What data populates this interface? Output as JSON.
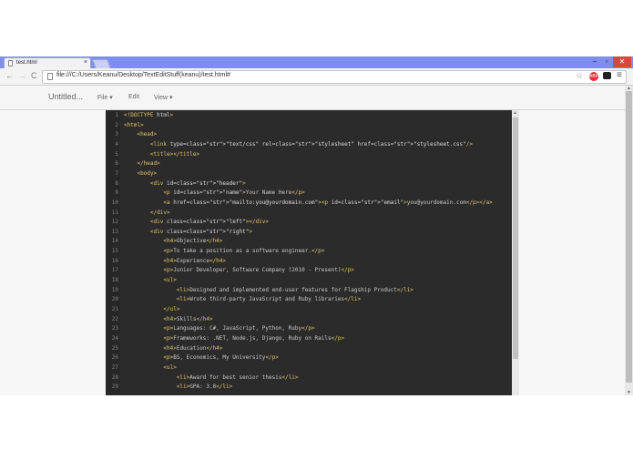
{
  "browser": {
    "tab_title": "test.html",
    "tab_close": "×",
    "url": "file:///C:/Users/Keanu/Desktop/TextEditStuff(keanu)/test.html#",
    "window_controls": {
      "minimize": "–",
      "maximize": "▫",
      "close": "✕"
    },
    "nav": {
      "back": "←",
      "forward": "→",
      "reload": "C"
    },
    "star_icon": "☆",
    "extension_badge": "ABP",
    "menu_icon": "≡"
  },
  "app": {
    "doc_title": "Untitled...",
    "menus": [
      {
        "label": "File ▾"
      },
      {
        "label": "Edit"
      },
      {
        "label": "View ▾"
      }
    ]
  },
  "editor": {
    "lines": [
      {
        "n": "1",
        "code": "<!DOCTYPE html>"
      },
      {
        "n": "2",
        "code": "<html>"
      },
      {
        "n": "3",
        "code": "    <head>"
      },
      {
        "n": "4",
        "code": "        <link type=\"text/css\" rel=\"stylesheet\" href=\"stylesheet.css\"/>"
      },
      {
        "n": "5",
        "code": "        <title></title>"
      },
      {
        "n": "6",
        "code": "    </head>"
      },
      {
        "n": "7",
        "code": "    <body>"
      },
      {
        "n": "8",
        "code": "        <div id=\"header\">"
      },
      {
        "n": "9",
        "code": "            <p id=\"name\">Your Name Here</p>"
      },
      {
        "n": "10",
        "code": "            <a href=\"mailto:you@yourdomain.com\"><p id=\"email\">you@yourdomain.com</p></a>"
      },
      {
        "n": "11",
        "code": "        </div>"
      },
      {
        "n": "12",
        "code": "        <div class=\"left\"></div>"
      },
      {
        "n": "13",
        "code": "        <div class=\"right\">"
      },
      {
        "n": "14",
        "code": "            <h4>Objective</h4>"
      },
      {
        "n": "15",
        "code": "            <p>To take a position as a software engineer.</p>"
      },
      {
        "n": "16",
        "code": "            <h4>Experience</h4>"
      },
      {
        "n": "17",
        "code": "            <p>Junior Developer, Software Company (2010 - Present)</p>"
      },
      {
        "n": "18",
        "code": "            <ul>"
      },
      {
        "n": "19",
        "code": "                <li>Designed and implemented end-user features for Flagship Product</li>"
      },
      {
        "n": "20",
        "code": "                <li>Wrote third-party JavaScript and Ruby libraries</li>"
      },
      {
        "n": "21",
        "code": "            </ul>"
      },
      {
        "n": "22",
        "code": "            <h4>Skills</h4>"
      },
      {
        "n": "23",
        "code": "            <p>Languages: C#, JavaScript, Python, Ruby</p>"
      },
      {
        "n": "24",
        "code": "            <p>Frameworks: .NET, Node.js, Django, Ruby on Rails</p>"
      },
      {
        "n": "25",
        "code": "            <h4>Education</h4>"
      },
      {
        "n": "26",
        "code": "            <p>BS, Economics, My University</p>"
      },
      {
        "n": "27",
        "code": "            <ul>"
      },
      {
        "n": "28",
        "code": "                <li>Award for best senior thesis</li>"
      },
      {
        "n": "29",
        "code": "                <li>GPA: 3.8</li>"
      }
    ]
  },
  "colors": {
    "titlebar": "#7e8ef0",
    "editor_bg": "#2b2b2b",
    "tag": "#e0c26a",
    "string": "#a8d37a",
    "line_number": "#858585"
  }
}
